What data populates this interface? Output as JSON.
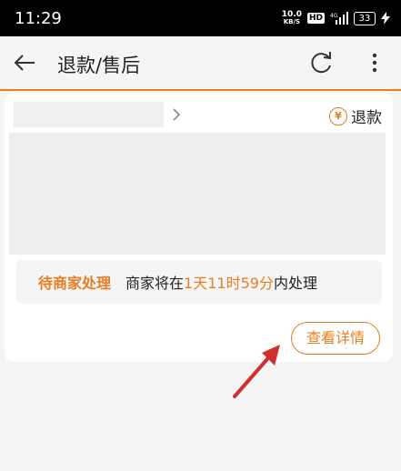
{
  "status_bar": {
    "time": "11:29",
    "net_speed_value": "10.0",
    "net_speed_unit": "KB/S",
    "hd_badge": "HD",
    "signal_label": "4G",
    "battery": "33"
  },
  "header": {
    "title": "退款/售后",
    "icons": [
      "back-arrow-icon",
      "refresh-icon",
      "more-icon"
    ]
  },
  "order": {
    "refund_icon_text": "¥",
    "refund_label": "退款",
    "status_label": "待商家处理",
    "desc_before": "商家将在",
    "desc_time": "1天11时59分",
    "desc_after": "内处理",
    "detail_button": "查看详情"
  },
  "colors": {
    "accent": "#e67e22",
    "arrow": "#d32f2f"
  }
}
